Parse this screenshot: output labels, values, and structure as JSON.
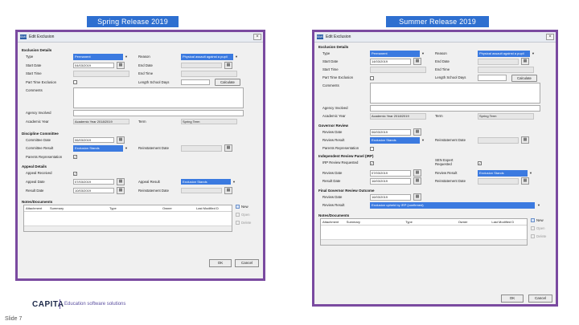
{
  "banners": {
    "left": "Spring Release 2019",
    "right": "Summer Release 2019"
  },
  "left": {
    "title": "Edit Exclusion",
    "exclusion_details": {
      "heading": "Exclusion Details",
      "type_label": "Type",
      "type_value": "Permanent",
      "reason_label": "Reason",
      "reason_value": "Physical assault against a pupil",
      "start_date_label": "Start Date",
      "start_date_value": "04/03/2019",
      "end_date_label": "End Date",
      "start_time_label": "Start Time",
      "end_time_label": "End Time",
      "part_time_label": "Part Time Exclusion",
      "length_label": "Length School Days",
      "calculate_label": "Calculate",
      "comments_label": "Comments",
      "agency_label": "Agency Involved",
      "academic_year_label": "Academic Year",
      "academic_year_value": "Academic Year 2018/2019",
      "term_label": "Term",
      "term_value": "Spring Term"
    },
    "discipline": {
      "heading": "Discipline Committee",
      "committee_date_label": "Committee Date",
      "committee_date_value": "06/03/2019",
      "committee_result_label": "Committee Result",
      "committee_result_value": "Exclusion Stands",
      "reinstatement_label": "Reinstatement Date",
      "parents_label": "Parents Representation"
    },
    "appeal": {
      "heading": "Appeal Details",
      "received_label": "Appeal Received",
      "appeal_date_label": "Appeal Date",
      "appeal_date_value": "07/03/2019",
      "appeal_result_label": "Appeal Result",
      "appeal_result_value": "Exclusion Stands",
      "result_date_label": "Result Date",
      "result_date_value": "10/03/2019",
      "reinstatement_label": "Reinstatement Date"
    },
    "notes": {
      "heading": "Notes/Documents",
      "columns": [
        "Attachment",
        "Summary",
        "Type",
        "Owner",
        "Last Modified D"
      ],
      "new_label": "New",
      "open_label": "Open",
      "delete_label": "Delete"
    },
    "ok_label": "OK",
    "cancel_label": "Cancel"
  },
  "right": {
    "title": "Edit Exclusion",
    "exclusion_details": {
      "heading": "Exclusion Details",
      "type_label": "Type",
      "type_value": "Permanent",
      "reason_label": "Reason",
      "reason_value": "Physical assault against a pupil",
      "start_date_label": "Start Date",
      "start_date_value": "14/03/2019",
      "end_date_label": "End Date",
      "start_time_label": "Start Time",
      "end_time_label": "End Time",
      "part_time_label": "Part Time Exclusion",
      "length_label": "Length School Days",
      "calculate_label": "Calculate",
      "comments_label": "Comments",
      "agency_label": "Agency Involved",
      "academic_year_label": "Academic Year",
      "academic_year_value": "Academic Year 2018/2019",
      "term_label": "Term",
      "term_value": "Spring Term"
    },
    "governor": {
      "heading": "Governor Review",
      "review_date_label": "Review Date",
      "review_date_value": "06/03/2019",
      "review_result_label": "Review Result",
      "review_result_value": "Exclusion Stands",
      "reinstatement_label": "Reinstatement Date",
      "parents_label": "Parents Representation"
    },
    "irp": {
      "heading": "Independent Review Panel (IRP)",
      "requested_label": "IRP Review Requested",
      "sen_label": "SEN Expert Requested",
      "review_date_label": "Review Date",
      "review_date_value": "07/03/2019",
      "review_result_label": "Review Result",
      "review_result_value": "Exclusion Stands",
      "result_date_label": "Result Date",
      "result_date_value": "16/03/2019",
      "reinstatement_label": "Reinstatement Date"
    },
    "final": {
      "heading": "Final Governor Review Outcome",
      "review_date_label": "Review Date",
      "review_date_value": "16/03/2019",
      "review_result_label": "Review Result",
      "review_result_value": "Exclusion upheld by IRP (confirmed)"
    },
    "notes": {
      "heading": "Notes/Documents",
      "columns": [
        "Attachment",
        "Summary",
        "Type",
        "Owner",
        "Last Modified D"
      ],
      "new_label": "New",
      "open_label": "Open",
      "delete_label": "Delete"
    },
    "ok_label": "OK",
    "cancel_label": "Cancel"
  },
  "footer": {
    "logo": "CAPITA",
    "tagline": "Education software solutions",
    "slide": "Slide 7"
  },
  "colors": {
    "banner": "#2e6fd0",
    "window_border": "#7a4aa0",
    "highlight": "#3b7ae0"
  }
}
